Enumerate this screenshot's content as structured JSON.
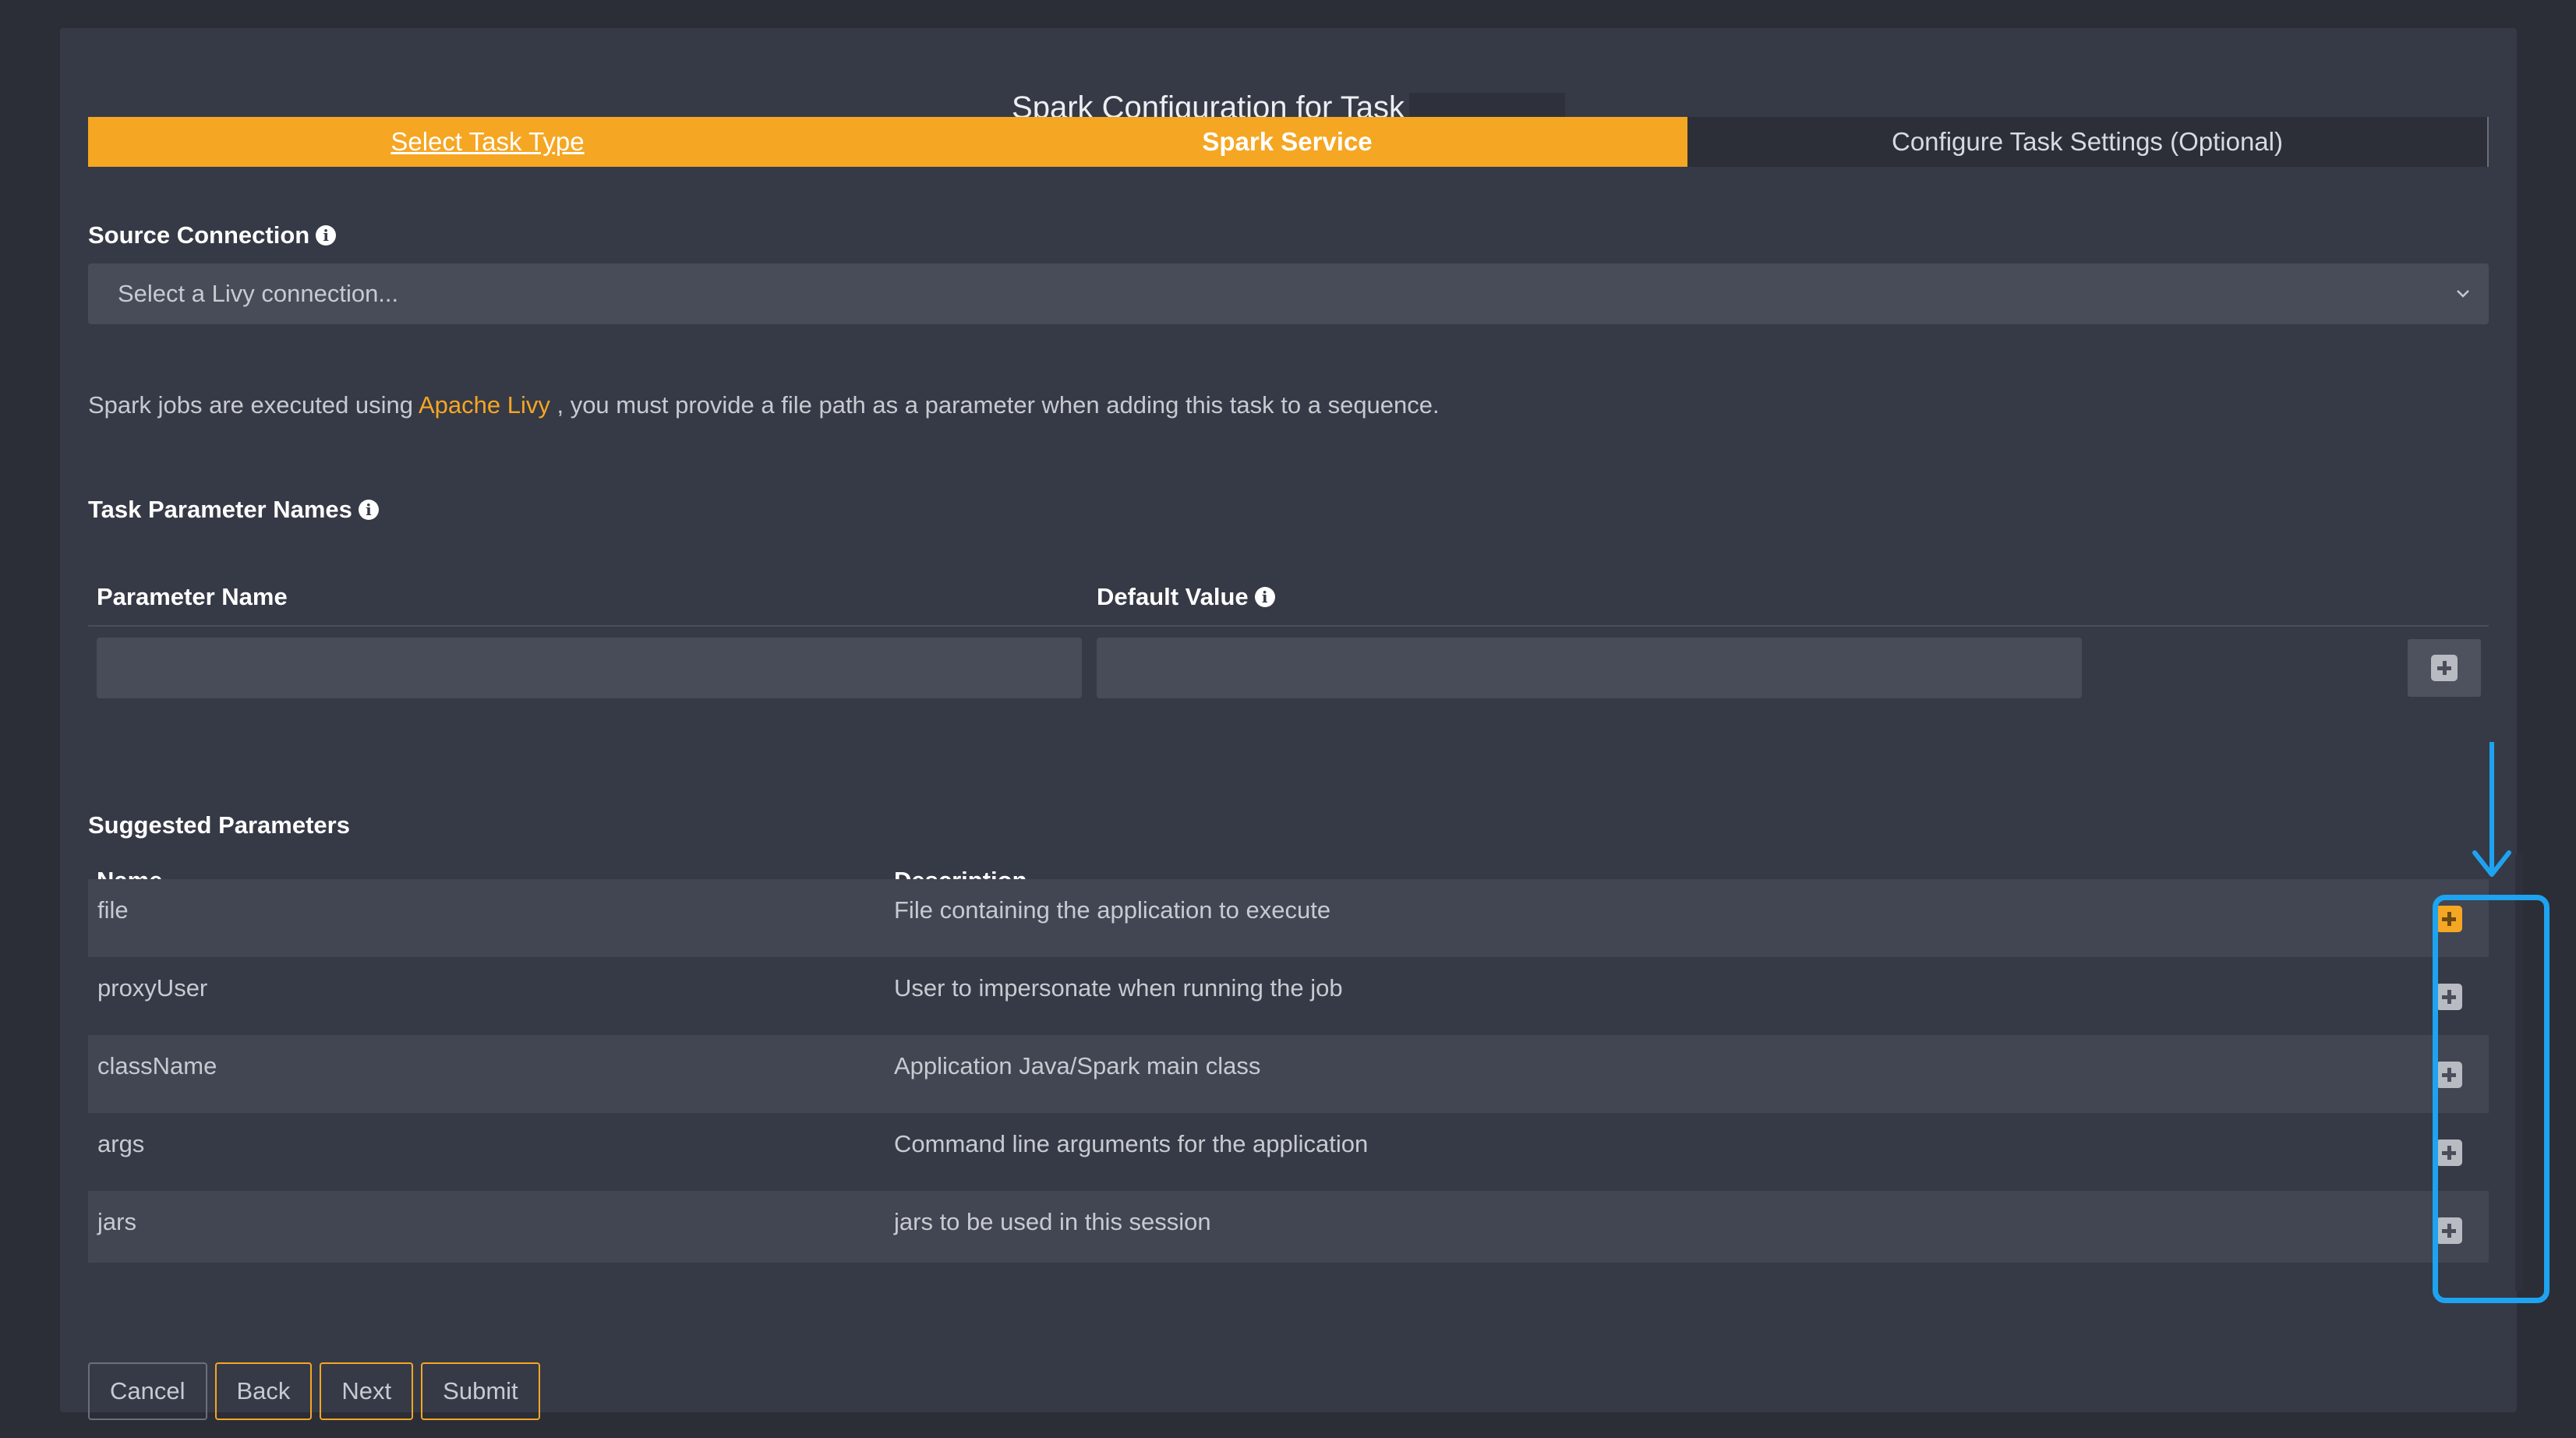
{
  "modal": {
    "title": "Spark Configuration for Task"
  },
  "wizard": {
    "steps": [
      {
        "label": "Select Task Type",
        "state": "done"
      },
      {
        "label": "Spark Service",
        "state": "active"
      },
      {
        "label": "Configure Task Settings (Optional)",
        "state": "todo"
      }
    ]
  },
  "source": {
    "label": "Source Connection",
    "placeholder": "Select a Livy connection..."
  },
  "helper": {
    "prefix": "Spark jobs are executed using",
    "link": "Apache Livy",
    "suffix": ", you must provide a file path as a parameter when adding this task to a sequence."
  },
  "params": {
    "section_title": "Task Parameter Names",
    "col_name": "Parameter Name",
    "col_default": "Default Value",
    "name_value": "",
    "default_value": ""
  },
  "suggested": {
    "section_title": "Suggested Parameters",
    "col_name": "Name",
    "col_desc": "Description",
    "rows": [
      {
        "name": "file",
        "desc": "File containing the application to execute"
      },
      {
        "name": "proxyUser",
        "desc": "User to impersonate when running the job"
      },
      {
        "name": "className",
        "desc": "Application Java/Spark main class"
      },
      {
        "name": "args",
        "desc": "Command line arguments for the application"
      },
      {
        "name": "jars",
        "desc": "jars to be used in this session"
      }
    ]
  },
  "footer": {
    "cancel": "Cancel",
    "back": "Back",
    "next": "Next",
    "submit": "Submit"
  },
  "colors": {
    "accent": "#f5a623",
    "highlight": "#1ea3f0",
    "background": "#363a46"
  }
}
